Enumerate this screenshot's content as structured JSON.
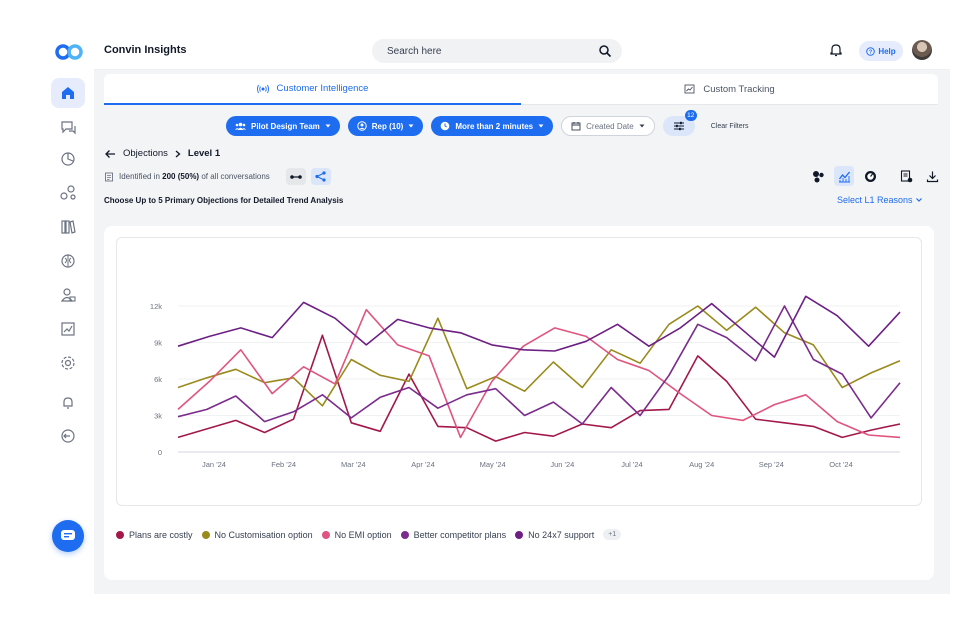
{
  "app": {
    "title": "Convin Insights",
    "brand_color": "#1e6cf0"
  },
  "header": {
    "search_placeholder": "Search here",
    "help_label": "Help"
  },
  "sidebar": {
    "items": [
      "home-icon",
      "conversations-icon",
      "analytics-icon",
      "network-icon",
      "library-icon",
      "brain-icon",
      "people-icon",
      "trend-icon",
      "settings-icon",
      "alert-icon",
      "logout-icon"
    ]
  },
  "tabs": [
    {
      "label": "Customer Intelligence",
      "active": true
    },
    {
      "label": "Custom Tracking",
      "active": false
    }
  ],
  "filters": {
    "team": "Pilot Design Team",
    "rep_prefix": "Rep ",
    "rep_count": "(10)",
    "duration": "More than 2 minutes",
    "date": "Created Date",
    "filter_count": "12",
    "clear_label": "Clear Filters"
  },
  "breadcrumb": {
    "parent": "Objections",
    "current": "Level 1"
  },
  "identified": {
    "prefix": "Identified in",
    "count": "200",
    "percent": "(50%)",
    "suffix": "of all conversations"
  },
  "instruction": "Choose Up to 5 Primary Objections for Detailed Trend Analysis",
  "select_reasons_label": "Select L1 Reasons",
  "legend_more": "+1",
  "chart_data": {
    "type": "line",
    "x": [
      "Jan '24",
      "",
      "Feb '24",
      "",
      "Mar '24",
      "",
      "Apr '24",
      "",
      "May '24",
      "",
      "Jun '24",
      "",
      "Jul '24",
      "",
      "Aug '24",
      "",
      "Sep '24",
      "",
      "Oct '24",
      ""
    ],
    "x_tick_labels": [
      "Jan '24",
      "Feb '24",
      "Mar '24",
      "Apr '24",
      "May '24",
      "Jun '24",
      "Jul '24",
      "Aug '24",
      "Sep '24",
      "Oct '24"
    ],
    "y_ticks": [
      "0",
      "3k",
      "6k",
      "9k",
      "12k"
    ],
    "ylim": [
      0,
      12000
    ],
    "grid": "horizontal",
    "series": [
      {
        "name": "Plans are costly",
        "color": "#a3184a",
        "values": [
          1200,
          1900,
          2600,
          1600,
          2700,
          9600,
          2400,
          1700,
          6400,
          2100,
          2000,
          900,
          1600,
          1300,
          2300,
          2000,
          3400,
          3500,
          7900,
          5800,
          2700,
          2400,
          2100,
          1200,
          1800,
          2300
        ]
      },
      {
        "name": "No Customisation option",
        "color": "#9a8a1c",
        "values": [
          5300,
          6100,
          6800,
          5700,
          6100,
          3800,
          7600,
          6300,
          5800,
          11000,
          5200,
          6200,
          5000,
          7400,
          5300,
          8400,
          7300,
          10500,
          12000,
          10000,
          11900,
          9800,
          8800,
          5300,
          6500,
          7500
        ]
      },
      {
        "name": "No EMI option",
        "color": "#e0547f",
        "values": [
          3500,
          5800,
          8400,
          4800,
          7000,
          5600,
          11700,
          8800,
          7900,
          1200,
          5800,
          8700,
          10200,
          9500,
          7600,
          6700,
          4800,
          3000,
          2600,
          3900,
          4700,
          2500,
          1400,
          1200
        ]
      },
      {
        "name": "Better competitor plans",
        "color": "#7b2c8c",
        "values": [
          2900,
          3500,
          4600,
          2500,
          3300,
          4700,
          2800,
          4500,
          5300,
          3600,
          4700,
          5200,
          3000,
          4100,
          2300,
          5300,
          3000,
          6300,
          10500,
          9400,
          7500,
          12000,
          7600,
          6400,
          2800,
          5700
        ]
      },
      {
        "name": "No 24x7 support",
        "color": "#6d1f84",
        "values": [
          8700,
          9500,
          10200,
          9400,
          12300,
          11000,
          8800,
          10900,
          10200,
          9800,
          8800,
          8400,
          8300,
          9100,
          10500,
          8700,
          10200,
          12200,
          10000,
          7800,
          12800,
          11200,
          8700,
          11500
        ]
      }
    ]
  }
}
